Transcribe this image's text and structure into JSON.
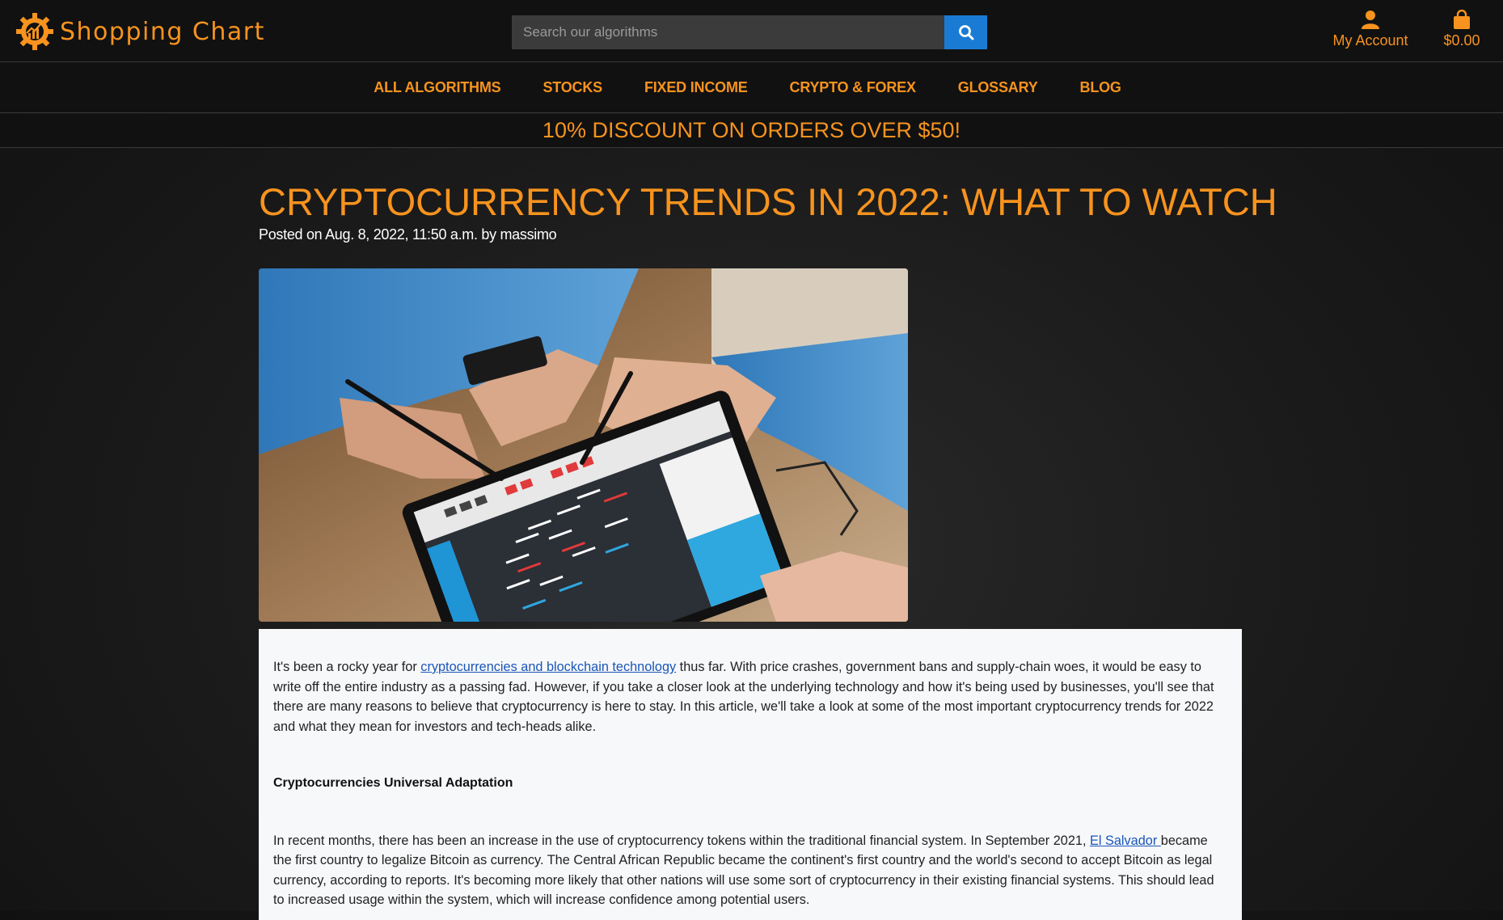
{
  "brand": {
    "name": "Shopping Chart",
    "color": "#f7931e"
  },
  "search": {
    "placeholder": "Search our algorithms",
    "button_color": "#1a7bd4"
  },
  "header": {
    "account_label": "My Account",
    "cart_total": "$0.00"
  },
  "nav": {
    "items": [
      {
        "label": "ALL ALGORITHMS"
      },
      {
        "label": "STOCKS"
      },
      {
        "label": "FIXED INCOME"
      },
      {
        "label": "CRYPTO & FOREX"
      },
      {
        "label": "GLOSSARY"
      },
      {
        "label": "BLOG"
      }
    ]
  },
  "promo": {
    "text": "10% DISCOUNT ON ORDERS OVER $50!"
  },
  "post": {
    "title": "CRYPTOCURRENCY TRENDS IN 2022: WHAT TO WATCH",
    "meta": "Posted on Aug. 8, 2022, 11:50 a.m. by massimo",
    "p1_before": "It's been a rocky year for ",
    "p1_link": "cryptocurrencies and blockchain technology",
    "p1_after": " thus far. With price crashes, government bans and supply-chain woes, it would be easy to write off the entire industry as a passing fad. However, if you take a closer look at the underlying technology and how it's being used by businesses, you'll see that there are many reasons to believe that cryptocurrency is here to stay. In this article, we'll take a look at some of the most important cryptocurrency trends for 2022 and what they mean for investors and tech-heads alike.",
    "heading1": "Cryptocurrencies Universal Adaptation",
    "p2_before": "In recent months, there has been an increase in the use of cryptocurrency tokens within the traditional financial system. In September 2021, ",
    "p2_link": "El Salvador ",
    "p2_after": "became the first country to legalize Bitcoin as currency. The Central African Republic became the continent's first country and the world's second to accept Bitcoin as legal currency, according to reports. It's becoming more likely that other nations will use some sort of cryptocurrency in their existing financial systems. This should lead to increased usage within the system, which will increase confidence among potential users."
  }
}
